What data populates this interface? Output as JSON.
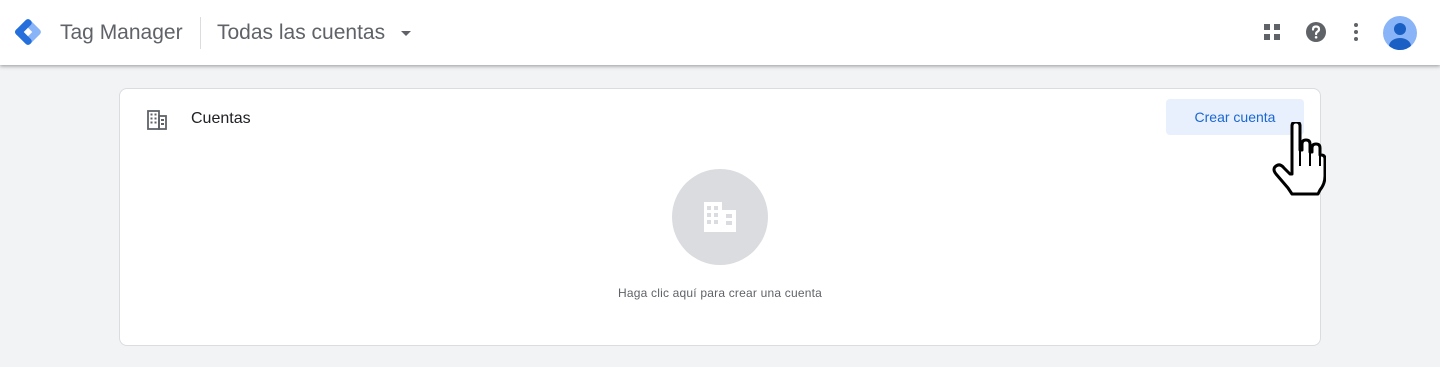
{
  "header": {
    "app_title": "Tag Manager",
    "account_selector": "Todas las cuentas",
    "icons": [
      "tag-manager-logo",
      "apps-grid-icon",
      "help-icon",
      "more-vert-icon",
      "account-avatar"
    ]
  },
  "card": {
    "title": "Cuentas",
    "create_button": "Crear cuenta",
    "empty_message": "Haga clic aquí para crear una cuenta",
    "icons": [
      "building-icon",
      "building-icon"
    ]
  },
  "colors": {
    "accent": "#1967d2",
    "button_bg": "#e8f0fe",
    "background": "#f1f3f4",
    "logo_dark": "#246fdb",
    "logo_light": "#8ab4f8"
  }
}
